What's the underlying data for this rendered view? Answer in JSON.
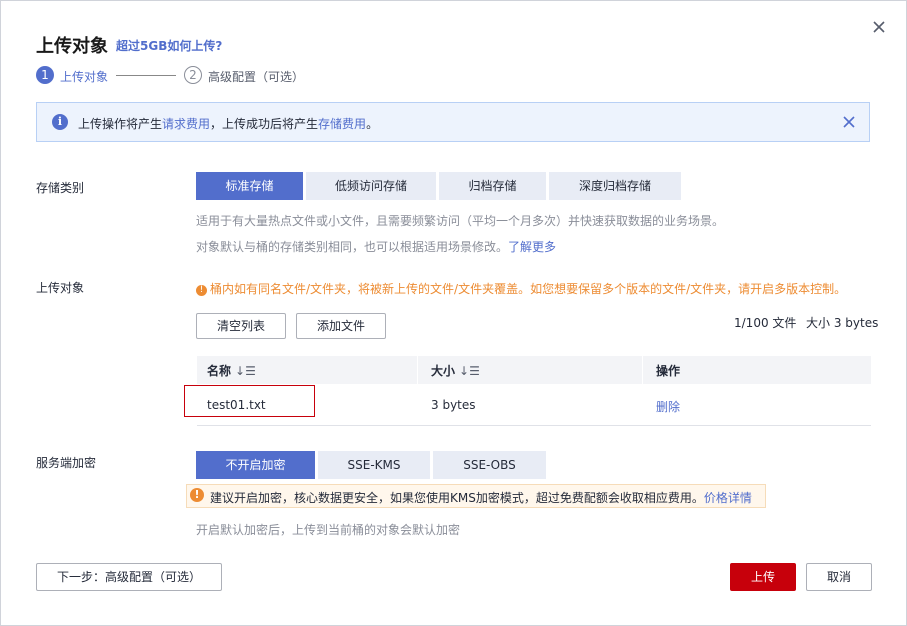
{
  "dialog": {
    "title": "上传对象",
    "title_link": "超过5GB如何上传?",
    "close_icon": "close-icon"
  },
  "steps": [
    {
      "number": "1",
      "label": "上传对象"
    },
    {
      "number": "2",
      "label": "高级配置（可选）"
    }
  ],
  "notice": {
    "text_1": "上传操作将产生",
    "link_1": "请求费用",
    "text_2": "，上传成功后将产生",
    "link_2": "存储费用",
    "text_3": "。"
  },
  "storage_class": {
    "label": "存储类别",
    "options": [
      "标准存储",
      "低频访问存储",
      "归档存储",
      "深度归档存储"
    ],
    "selected": "标准存储",
    "hint_1": "适用于有大量热点文件或小文件，且需要频繁访问（平均一个月多次）并快速获取数据的业务场景。",
    "hint_2": "对象默认与桶的存储类别相同，也可以根据适用场景修改。",
    "hint_link": "了解更多"
  },
  "upload": {
    "label": "上传对象",
    "warning": "桶内如有同名文件/文件夹，将被新上传的文件/文件夹覆盖。如您想要保留多个版本的文件/文件夹，请开启多版本控制。",
    "clear_button": "清空列表",
    "add_button": "添加文件",
    "file_count": "1/100 文件",
    "total_size": "大小 3 bytes",
    "columns": [
      "名称",
      "大小",
      "操作"
    ],
    "sort_glyph": "↓☰",
    "rows": [
      {
        "name": "test01.txt",
        "size": "3 bytes",
        "action": "删除"
      }
    ]
  },
  "encryption": {
    "label": "服务端加密",
    "options": [
      "不开启加密",
      "SSE-KMS",
      "SSE-OBS"
    ],
    "selected": "不开启加密",
    "warning": "建议开启加密，核心数据更安全，如果您使用KMS加密模式，超过免费配额会收取相应费用。",
    "warning_link": "价格详情",
    "hint": "开启默认加密后，上传到当前桶的对象会默认加密"
  },
  "footer": {
    "next_button": "下一步：高级配置（可选）",
    "upload_button": "上传",
    "cancel_button": "取消"
  },
  "colors": {
    "accent": "#526ecc",
    "primary_button": "#c7000b",
    "warning": "#ed8c33"
  }
}
